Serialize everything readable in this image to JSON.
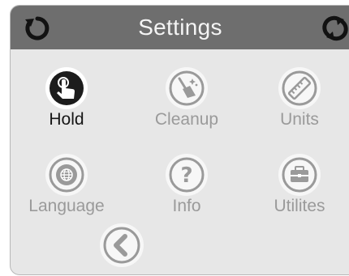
{
  "header": {
    "title": "Settings",
    "left_icon": "refresh-icon",
    "right_icon": "sync-icon"
  },
  "menu": [
    {
      "label": "Hold",
      "icon": "hand-touch-icon",
      "active": true
    },
    {
      "label": "Cleanup",
      "icon": "broom-icon",
      "active": false
    },
    {
      "label": "Units",
      "icon": "ruler-icon",
      "active": false
    },
    {
      "label": "Language",
      "icon": "globe-icon",
      "active": false
    },
    {
      "label": "Info",
      "icon": "help-icon",
      "active": false
    },
    {
      "label": "Utilites",
      "icon": "toolbox-icon",
      "active": false
    }
  ],
  "back": {
    "icon": "chevron-left-icon"
  },
  "colors": {
    "header_bg": "#6e6e6e",
    "panel_bg": "#e7e7e7",
    "active_text": "#161616",
    "inactive_text": "#9a9a9a",
    "active_icon": "#1c1c1c",
    "inactive_icon": "#9a9a9a"
  }
}
